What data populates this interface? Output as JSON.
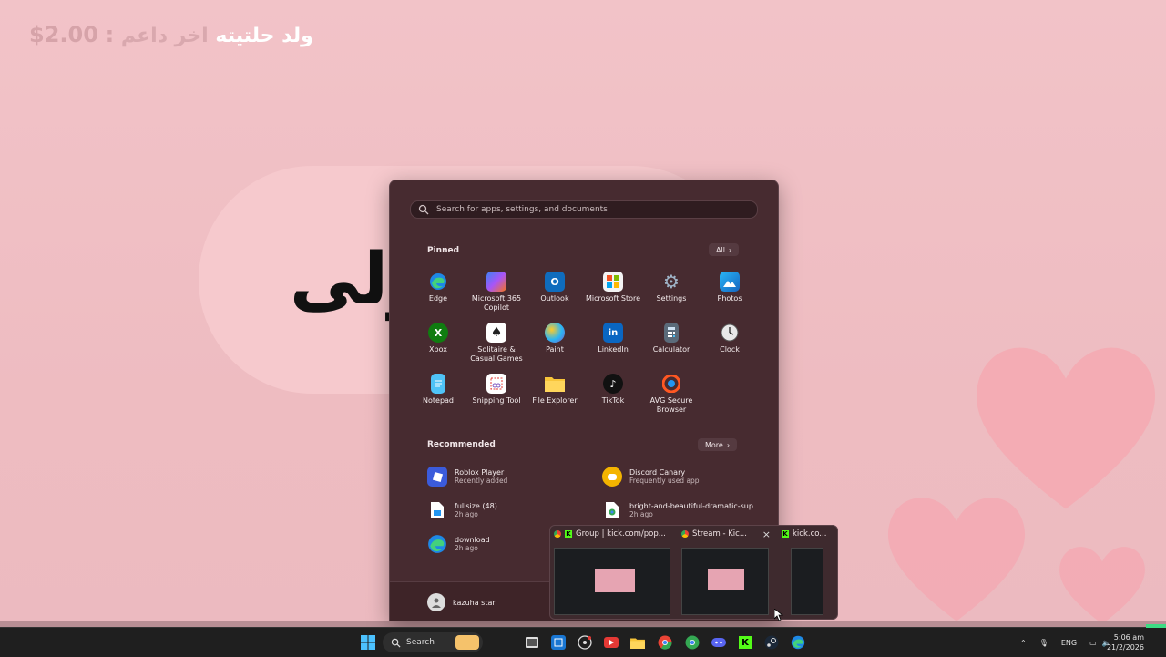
{
  "overlay": {
    "prefix": "اخر داعم",
    "donor": "ولد حلتيته",
    "separator": ":",
    "amount": "$2.00",
    "big_text": "ولى"
  },
  "start_menu": {
    "search_placeholder": "Search for apps, settings, and documents",
    "pinned_title": "Pinned",
    "all_button": "All",
    "pinned": [
      {
        "label": "Edge",
        "icon": "edge-icon"
      },
      {
        "label": "Microsoft 365 Copilot",
        "icon": "copilot-icon"
      },
      {
        "label": "Outlook",
        "icon": "outlook-icon"
      },
      {
        "label": "Microsoft Store",
        "icon": "store-icon"
      },
      {
        "label": "Settings",
        "icon": "settings-icon"
      },
      {
        "label": "Photos",
        "icon": "photos-icon"
      },
      {
        "label": "Xbox",
        "icon": "xbox-icon"
      },
      {
        "label": "Solitaire & Casual Games",
        "icon": "solitaire-icon"
      },
      {
        "label": "Paint",
        "icon": "paint-icon"
      },
      {
        "label": "LinkedIn",
        "icon": "linkedin-icon"
      },
      {
        "label": "Calculator",
        "icon": "calculator-icon"
      },
      {
        "label": "Clock",
        "icon": "clock-icon"
      },
      {
        "label": "Notepad",
        "icon": "notepad-icon"
      },
      {
        "label": "Snipping Tool",
        "icon": "snipping-icon"
      },
      {
        "label": "File Explorer",
        "icon": "folder-icon"
      },
      {
        "label": "TikTok",
        "icon": "tiktok-icon"
      },
      {
        "label": "AVG Secure Browser",
        "icon": "avg-icon"
      }
    ],
    "recommended_title": "Recommended",
    "more_button": "More",
    "recommended": [
      {
        "title": "Roblox Player",
        "sub": "Recently added",
        "icon": "roblox-icon"
      },
      {
        "title": "Discord Canary",
        "sub": "Frequently used app",
        "icon": "discord-icon"
      },
      {
        "title": "fullsize (48)",
        "sub": "2h ago",
        "icon": "file-icon"
      },
      {
        "title": "bright-and-beautiful-dramatic-sup...",
        "sub": "2h ago",
        "icon": "chrome-file-icon"
      },
      {
        "title": "download",
        "sub": "2h ago",
        "icon": "edge-icon"
      }
    ],
    "user_name": "kazuha star"
  },
  "thumbnails": [
    {
      "title": "Group | kick.com/pop..."
    },
    {
      "title": "Stream - Kic..."
    },
    {
      "title": "kick.co..."
    }
  ],
  "taskbar": {
    "search_label": "Search",
    "lang": "ENG",
    "time": "5:06 am",
    "date": "21/2/2026"
  },
  "colors": {
    "background": "#f0bfc4",
    "start_menu": "#472b30",
    "taskbar": "#1f1f1f",
    "accent": "#53fc18"
  }
}
